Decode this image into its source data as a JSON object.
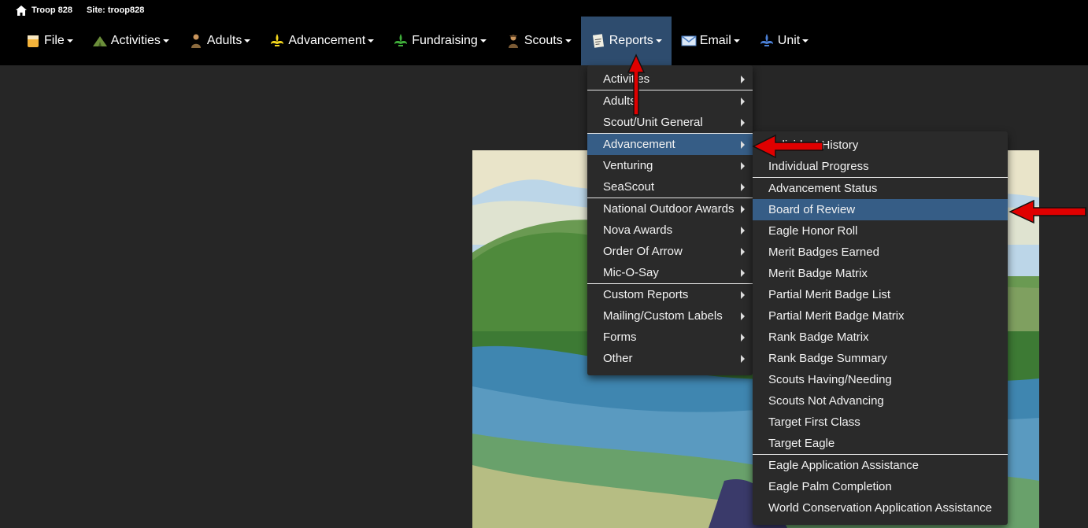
{
  "site": {
    "troop": "Troop 828",
    "site_label": "Site: troop828"
  },
  "nav": [
    {
      "label": "File",
      "icon": "file-icon"
    },
    {
      "label": "Activities",
      "icon": "tent-icon"
    },
    {
      "label": "Adults",
      "icon": "adult-icon"
    },
    {
      "label": "Advancement",
      "icon": "fleur-de-lis-icon"
    },
    {
      "label": "Fundraising",
      "icon": "fundraising-icon"
    },
    {
      "label": "Scouts",
      "icon": "scout-icon"
    },
    {
      "label": "Reports",
      "icon": "report-icon",
      "active": true
    },
    {
      "label": "Email",
      "icon": "envelope-icon"
    },
    {
      "label": "Unit",
      "icon": "unit-icon"
    }
  ],
  "reports_menu": [
    {
      "label": "Activities",
      "submenu": true
    },
    {
      "divider": true
    },
    {
      "label": "Adults",
      "submenu": true
    },
    {
      "label": "Scout/Unit General",
      "submenu": true
    },
    {
      "divider": true
    },
    {
      "label": "Advancement",
      "submenu": true,
      "active": true
    },
    {
      "label": "Venturing",
      "submenu": true
    },
    {
      "label": "SeaScout",
      "submenu": true
    },
    {
      "divider": true
    },
    {
      "label": "National Outdoor Awards",
      "submenu": true
    },
    {
      "label": "Nova Awards",
      "submenu": true
    },
    {
      "label": "Order Of Arrow",
      "submenu": true
    },
    {
      "label": "Mic-O-Say",
      "submenu": true
    },
    {
      "divider": true
    },
    {
      "label": "Custom Reports",
      "submenu": true
    },
    {
      "label": "Mailing/Custom Labels",
      "submenu": true
    },
    {
      "label": "Forms",
      "submenu": true
    },
    {
      "label": "Other",
      "submenu": true
    }
  ],
  "advancement_menu": [
    {
      "label": "Individual History"
    },
    {
      "label": "Individual Progress"
    },
    {
      "divider": true
    },
    {
      "label": "Advancement Status"
    },
    {
      "label": "Board of Review",
      "active": true
    },
    {
      "label": "Eagle Honor Roll"
    },
    {
      "label": "Merit Badges Earned"
    },
    {
      "label": "Merit Badge Matrix"
    },
    {
      "label": "Partial Merit Badge List"
    },
    {
      "label": "Partial Merit Badge Matrix"
    },
    {
      "label": "Rank Badge Matrix"
    },
    {
      "label": "Rank Badge Summary"
    },
    {
      "label": "Scouts Having/Needing"
    },
    {
      "label": "Scouts Not Advancing"
    },
    {
      "label": "Target First Class"
    },
    {
      "label": "Target Eagle"
    },
    {
      "divider": true
    },
    {
      "label": "Eagle Application Assistance"
    },
    {
      "label": "Eagle Palm Completion"
    },
    {
      "label": "World Conservation Application Assistance"
    }
  ],
  "colors": {
    "active_nav": "#2e4c6e",
    "active_item": "#365d86",
    "annotation_arrow": "#e00000"
  }
}
